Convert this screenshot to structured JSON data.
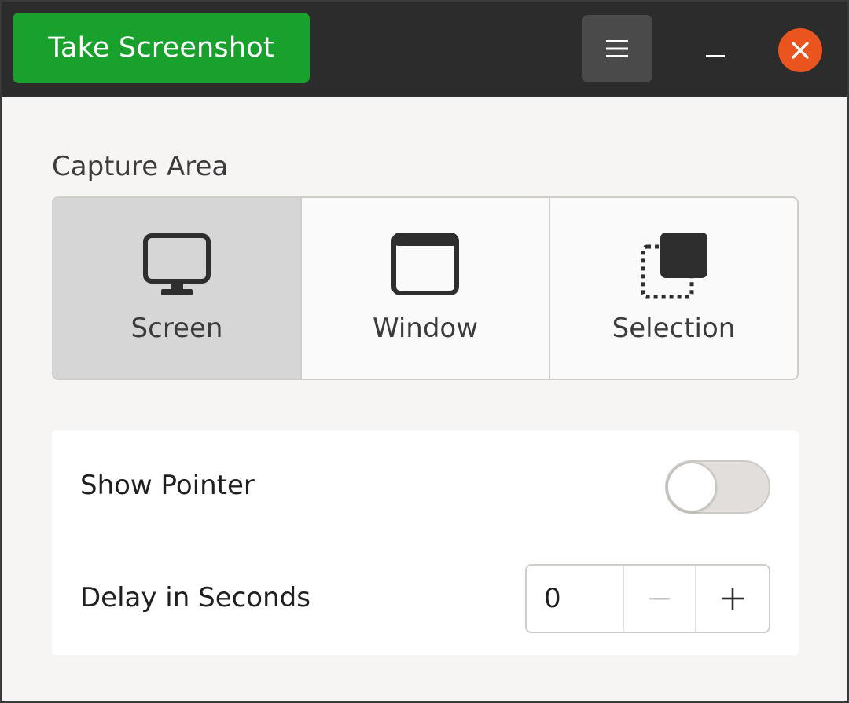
{
  "header": {
    "take_screenshot_label": "Take Screenshot",
    "accent_color": "#19a12e",
    "close_color": "#e9541f",
    "menu_icon": "hamburger-icon",
    "minimize_icon": "minimize-icon",
    "close_icon": "close-icon"
  },
  "capture_area": {
    "title": "Capture Area",
    "modes": [
      {
        "label": "Screen",
        "icon": "monitor-icon",
        "selected": true
      },
      {
        "label": "Window",
        "icon": "window-icon",
        "selected": false
      },
      {
        "label": "Selection",
        "icon": "selection-icon",
        "selected": false
      }
    ]
  },
  "options": {
    "show_pointer": {
      "label": "Show Pointer",
      "enabled": false
    },
    "delay": {
      "label": "Delay in Seconds",
      "value": "0",
      "minus_icon": "minus-icon",
      "plus_icon": "plus-icon"
    }
  }
}
